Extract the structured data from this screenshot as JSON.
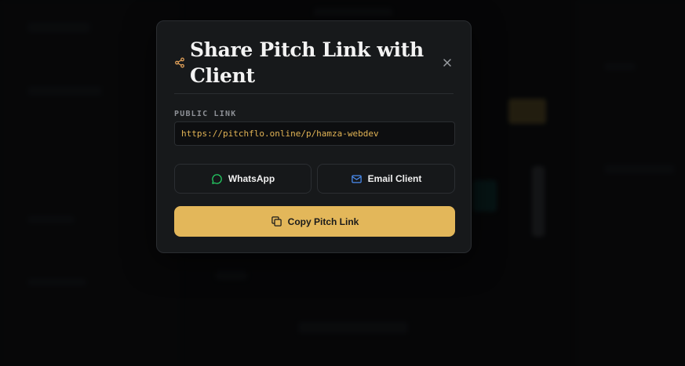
{
  "modal": {
    "title": "Share Pitch Link with Client",
    "public_link_label": "PUBLIC LINK",
    "public_link_value": "https://pitchflo.online/p/hamza-webdev",
    "whatsapp_label": "WhatsApp",
    "email_label": "Email Client",
    "copy_label": "Copy Pitch Link"
  },
  "icons": {
    "header": "share-icon",
    "close": "close-icon",
    "whatsapp": "whatsapp-icon",
    "email": "mail-icon",
    "copy": "copy-icon"
  },
  "colors": {
    "accent": "#e3b75a",
    "link_text": "#e2b455",
    "share_icon": "#e3a25a",
    "whatsapp_icon": "#25d366",
    "email_icon": "#4a8cf0",
    "modal_bg": "#17191b"
  }
}
